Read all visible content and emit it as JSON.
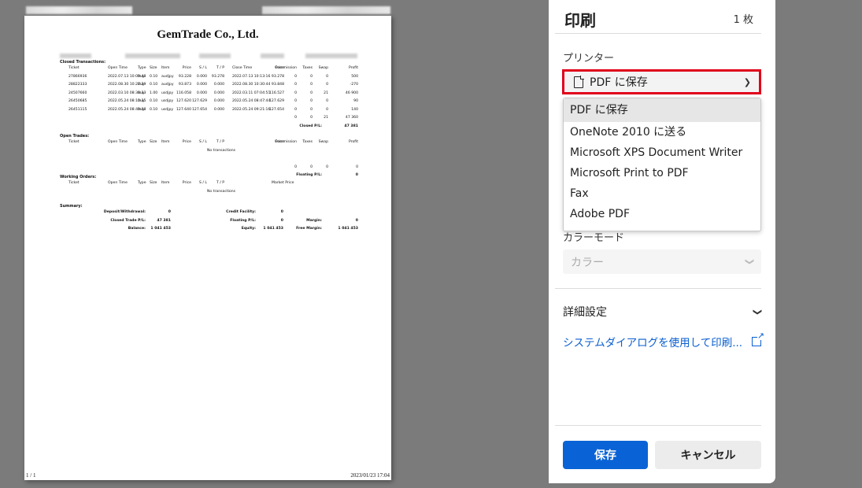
{
  "dialog": {
    "title": "印刷",
    "sheet_count": "1 枚",
    "printer_label": "プリンター",
    "printer_selected": "PDF に保存",
    "printer_options": [
      "PDF に保存",
      "OneNote 2010 に送る",
      "Microsoft XPS Document Writer",
      "Microsoft Print to PDF",
      "Fax",
      "Adobe PDF"
    ],
    "color_mode_label": "カラーモード",
    "color_mode_value": "カラー",
    "advanced_label": "詳細設定",
    "system_dialog_link": "システムダイアログを使用して印刷...",
    "save_button": "保存",
    "cancel_button": "キャンセル",
    "highlight_color": "#e0001a",
    "accent_color": "#0a63d6"
  },
  "preview": {
    "company": "GemTrade Co., Ltd.",
    "page_number": "1 / 1",
    "date": "2023/01/23 17:04",
    "closed": {
      "label": "Closed Transactions:",
      "headers": [
        "Ticket",
        "Open Time",
        "Type",
        "Size",
        "Item",
        "Price",
        "S / L",
        "T / P",
        "Close Time",
        "Price",
        "Commission",
        "Taxes",
        "Swap",
        "Profit"
      ],
      "rows": [
        [
          "27866936",
          "2022.07.13 10:09:48",
          "buy",
          "0.10",
          "audjpy",
          "93.228",
          "0.000",
          "93.278",
          "2022.07.13 10:13:16",
          "93.278",
          "0",
          "0",
          "0",
          "500"
        ],
        [
          "28822333",
          "2022.08.30 10:27:29",
          "buy",
          "0.10",
          "audjpy",
          "93.873",
          "0.000",
          "0.000",
          "2022.08.30 10:30:44",
          "93.848",
          "0",
          "0",
          "0",
          "-270"
        ],
        [
          "24507660",
          "2022.03.10 08:38:33",
          "buy",
          "1.00",
          "usdjpy",
          "116.058",
          "0.000",
          "0.000",
          "2022.03.11 07:04:51",
          "116.527",
          "0",
          "0",
          "21",
          "46 900"
        ],
        [
          "26450685",
          "2022.05.24 08:10:35",
          "buy",
          "0.10",
          "usdjpy",
          "127.620",
          "127.629",
          "0.000",
          "2022.05.24 08:47:44",
          "127.629",
          "0",
          "0",
          "0",
          "90"
        ],
        [
          "26451115",
          "2022.05.24 08:49:08",
          "buy",
          "0.10",
          "usdjpy",
          "127.640",
          "127.654",
          "0.000",
          "2022.05.24 09:21:16",
          "127.654",
          "0",
          "0",
          "0",
          "140"
        ]
      ],
      "totals": [
        "0",
        "0",
        "21",
        "47 360"
      ],
      "closed_pl_label": "Closed P/L:",
      "closed_pl_value": "47 381"
    },
    "open": {
      "label": "Open Trades:",
      "headers": [
        "Ticket",
        "Open Time",
        "Type",
        "Size",
        "Item",
        "Price",
        "S / L",
        "T / P",
        "Price",
        "Commission",
        "Taxes",
        "Swap",
        "Profit"
      ],
      "no_tx": "No transactions",
      "totals": [
        "0",
        "0",
        "0",
        "0"
      ],
      "floating_pl_label": "Floating P/L:",
      "floating_pl_value": "0"
    },
    "working": {
      "label": "Working Orders:",
      "headers": [
        "Ticket",
        "Open Time",
        "Type",
        "Size",
        "Item",
        "Price",
        "S / L",
        "T / P",
        "Market Price"
      ],
      "no_tx": "No transactions"
    },
    "summary": {
      "label": "Summary:",
      "deposit_label": "Deposit/Withdrawal:",
      "deposit_value": "0",
      "credit_label": "Credit Facility:",
      "credit_value": "0",
      "closed_trade_label": "Closed Trade P/L:",
      "closed_trade_value": "47 381",
      "floating_label": "Floating P/L:",
      "floating_value": "0",
      "margin_label": "Margin:",
      "margin_value": "0",
      "balance_label": "Balance:",
      "balance_value": "1 041 453",
      "equity_label": "Equity:",
      "equity_value": "1 041 453",
      "free_margin_label": "Free Margin:",
      "free_margin_value": "1 041 453"
    }
  }
}
